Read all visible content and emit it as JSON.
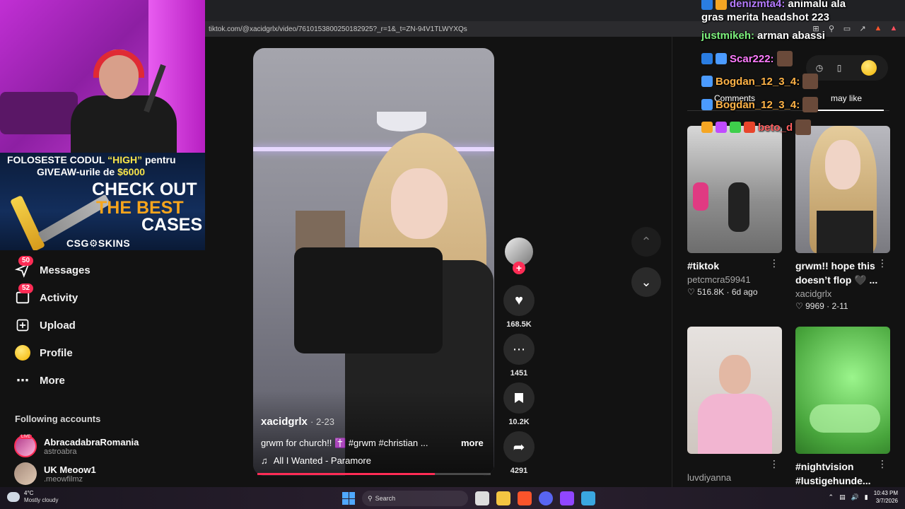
{
  "browser": {
    "url": "tiktok.com/@xacidgrlx/video/7610153800250182925?_r=1&_t=ZN-94V1TLWYXQs"
  },
  "overlay": {
    "promo": {
      "line1_a": "FOLOSESTE C",
      "line1_b": "ODUL",
      "line1_code": "“HIGH”",
      "line1_c": "pentru",
      "line2_a": "GIVEAW",
      "line2_b": "-urile de",
      "line2_amount": "$6000",
      "check_out": "CHECK OUT",
      "the_best": "THE BEST",
      "cases": "CASES",
      "brand": "CSG⚙SKINS"
    }
  },
  "sidebar": {
    "items": [
      {
        "label": "Messages",
        "badge": "50",
        "icon": "send-icon"
      },
      {
        "label": "Activity",
        "badge": "52",
        "icon": "inbox-icon"
      },
      {
        "label": "Upload",
        "icon": "plus-square-icon"
      },
      {
        "label": "Profile",
        "icon": "avatar-icon"
      },
      {
        "label": "More",
        "icon": "more-dots-icon"
      }
    ],
    "following_title": "Following accounts",
    "following": [
      {
        "name": "AbracadabraRomania",
        "handle": "astroabra",
        "live": "LIVE"
      },
      {
        "name": "UK Meoow1",
        "handle": ".meowfilmz"
      }
    ]
  },
  "video": {
    "author": "xacidgrlx",
    "date": "· 2-23",
    "description": "grwm for church!! ✝️ #grwm #christian ...",
    "more_label": "more",
    "music": "All I Wanted - Paramore",
    "progress": 0.76
  },
  "actions": {
    "likes": "168.5K",
    "comments": "1451",
    "saves": "10.2K",
    "shares": "4291"
  },
  "right_panel": {
    "tab_comments": "Comments",
    "tab_may_like": "may like",
    "cards": [
      {
        "title": "#tiktok",
        "user": "petcmcra59941",
        "likes": "516.8K",
        "age": "6d ago"
      },
      {
        "title": "grwm!! hope this doesn’t flop 🖤 ...",
        "user": "xacidgrlx",
        "likes": "9969",
        "age": "2-11"
      },
      {
        "title": "",
        "user": "luvdiyanna"
      },
      {
        "title": "#nightvision #lustigehunde...",
        "user": ""
      }
    ]
  },
  "chat": {
    "lines": [
      {
        "user": "denizmta4:",
        "text": "animalu ala",
        "color": "#b57bff"
      },
      {
        "user": "",
        "text": "gras merita headshot 223",
        "color": "#ffffff"
      },
      {
        "user": "justmikeh:",
        "text": "arman abassi",
        "color": "#7cf07c"
      },
      {
        "user": "Scar222:",
        "text": "",
        "color": "#ff7cff"
      },
      {
        "user": "Bogdan_12_3_4:",
        "text": "",
        "color": "#ffb347"
      },
      {
        "user": "Bogdan_12_3_4:",
        "text": "",
        "color": "#ffb347"
      },
      {
        "user": "beto_d",
        "text": "",
        "color": "#ff5e5e"
      }
    ]
  },
  "taskbar": {
    "temp": "4°C",
    "weather": "Mostly cloudy",
    "search": "Search",
    "time": "10:43 PM",
    "date": "3/7/2026"
  }
}
